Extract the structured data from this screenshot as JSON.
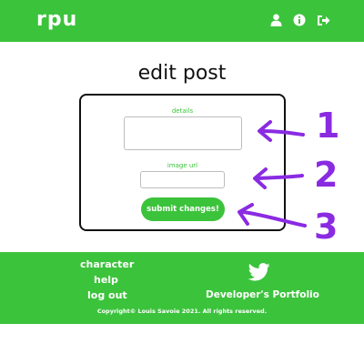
{
  "navbar": {
    "logo": "rpu",
    "icons": [
      "user-icon",
      "info-icon",
      "logout-icon"
    ]
  },
  "main": {
    "title": "edit post",
    "form": {
      "details_label": "details",
      "details_value": "",
      "image_url_label": "image url",
      "image_url_value": "",
      "submit_label": "submit changes!"
    },
    "annotations": [
      "1",
      "2",
      "3"
    ]
  },
  "footer": {
    "links": [
      "character",
      "help",
      "log out"
    ],
    "portfolio_label": "Developer's Portfolio",
    "copyright": "Copyright© Louis Savoie 2021. All rights reserved."
  },
  "colors": {
    "brand": "#3cc33c",
    "annotation": "#8a2be2"
  }
}
